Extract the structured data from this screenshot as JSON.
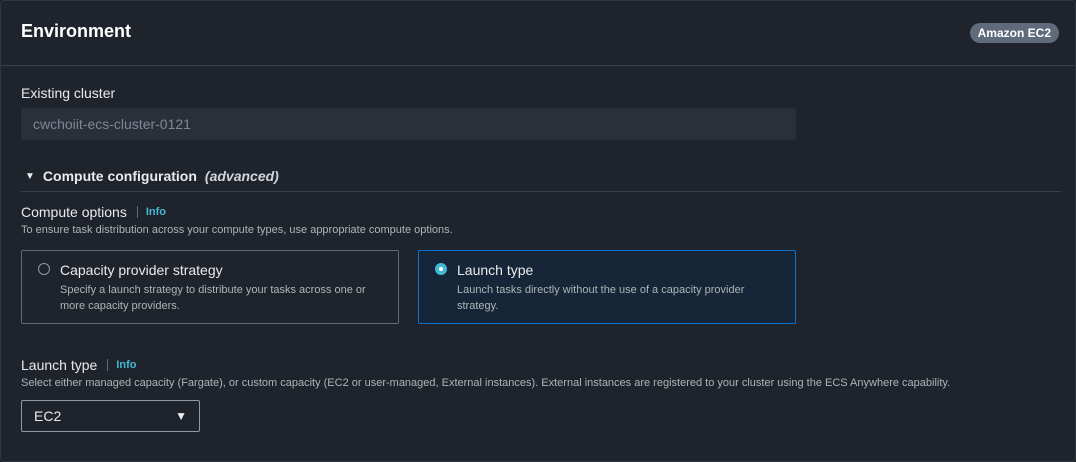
{
  "header": {
    "title": "Environment",
    "badge": "Amazon EC2"
  },
  "existing_cluster": {
    "label": "Existing cluster",
    "value": "cwchoiit-ecs-cluster-0121"
  },
  "compute_configuration": {
    "toggle_label": "Compute configuration",
    "toggle_suffix": "(advanced)",
    "options_label": "Compute options",
    "options_info": "Info",
    "options_description": "To ensure task distribution across your compute types, use appropriate compute options.",
    "tiles": [
      {
        "title": "Capacity provider strategy",
        "description": "Specify a launch strategy to distribute your tasks across one or more capacity providers.",
        "selected": false
      },
      {
        "title": "Launch type",
        "description": "Launch tasks directly without the use of a capacity provider strategy.",
        "selected": true
      }
    ]
  },
  "launch_type": {
    "label": "Launch type",
    "info": "Info",
    "description": "Select either managed capacity (Fargate), or custom capacity (EC2 or user-managed, External instances). External instances are registered to your cluster using the ECS Anywhere capability.",
    "selected_value": "EC2"
  },
  "colors": {
    "accent": "#44b9d6",
    "selected_border": "#0972d3"
  }
}
